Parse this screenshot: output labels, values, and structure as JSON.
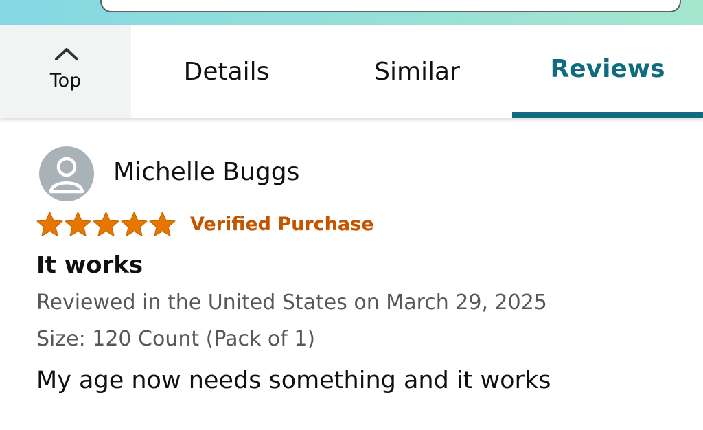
{
  "tabs": {
    "top_label": "Top",
    "items": [
      {
        "label": "Details",
        "active": false
      },
      {
        "label": "Similar",
        "active": false
      },
      {
        "label": "Reviews",
        "active": true
      }
    ]
  },
  "review": {
    "reviewer": "Michelle Buggs",
    "rating": 5,
    "rating_max": 5,
    "verified_label": "Verified Purchase",
    "title": "It works",
    "meta": "Reviewed in the United States on March 29, 2025",
    "variant": "Size: 120 Count (Pack of 1)",
    "body": "My age now needs something and it works"
  },
  "icons": {
    "chevron": "chevron-up-icon",
    "avatar": "person-icon",
    "star": "star-icon"
  },
  "colors": {
    "accent": "#0f6c7e",
    "star": "#e77600",
    "verified": "#c45500",
    "meta": "#565959"
  }
}
